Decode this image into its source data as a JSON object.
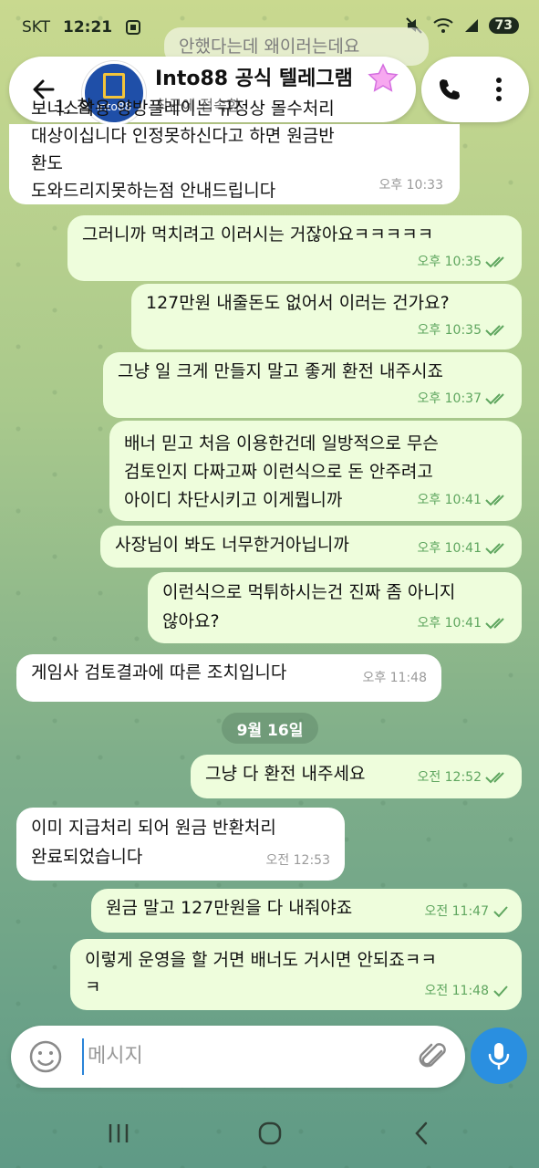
{
  "status_bar": {
    "carrier": "SKT",
    "time": "12:21",
    "battery": "73"
  },
  "header": {
    "title": "Into88 공식 텔레그램",
    "subtitle": "최근에 접속함",
    "avatar_text": "into88"
  },
  "ghost_messages": [
    {
      "text": "안했다는데 왜이러는데요"
    }
  ],
  "messages": [
    {
      "dir": "in",
      "text": "보너스악용 양방플레이는 규정상 몰수처리\n대상이십니다 인정못하신다고 하면 원금반환도\n도와드리지못하는점 안내드립니다",
      "time": "오후 10:33",
      "partial_top": "1, 참"
    },
    {
      "dir": "out",
      "text": "그러니까 먹치려고 이러시는 거잖아요ㅋㅋㅋㅋㅋ",
      "time": "오후 10:35"
    },
    {
      "dir": "out",
      "text": "127만원 내줄돈도 없어서 이러는 건가요?",
      "time": "오후 10:35"
    },
    {
      "dir": "out",
      "text": "그냥 일 크게 만들지 말고 좋게 환전 내주시죠",
      "time": "오후 10:37"
    },
    {
      "dir": "out",
      "text": "배너 믿고 처음 이용한건데 일방적으로 무슨\n검토인지 다짜고짜 이런식으로 돈 안주려고\n아이디 차단시키고 이게뭡니까",
      "time": "오후 10:41"
    },
    {
      "dir": "out",
      "text": "사장님이 봐도 너무한거아닙니까",
      "time": "오후 10:41"
    },
    {
      "dir": "out",
      "text": "이런식으로 먹튀하시는건 진짜 좀 아니지\n않아요?",
      "time": "오후 10:41"
    },
    {
      "dir": "in",
      "text": "게임사 검토결과에 따른 조치입니다",
      "time": "오후 11:48"
    },
    {
      "dir": "out",
      "text": "그냥 다 환전 내주세요",
      "time": "오전 12:52"
    },
    {
      "dir": "in",
      "text": "이미 지급처리 되어 원금 반환처리\n완료되었습니다",
      "time": "오전 12:53"
    },
    {
      "dir": "out",
      "text": "원금 말고 127만원을 다 내줘야죠",
      "time": "오전 11:47"
    },
    {
      "dir": "out",
      "text": "이렇게 운영을 할 거면 배너도 거시면 안되죠ㅋㅋ\nㅋ",
      "time": "오전 11:48"
    }
  ],
  "date_chip": "9월 16일",
  "composer": {
    "placeholder": "메시지"
  },
  "colors": {
    "outgoing_bubble": "#eefddc",
    "incoming_bubble": "#ffffff",
    "accent": "#2a8fe0"
  }
}
